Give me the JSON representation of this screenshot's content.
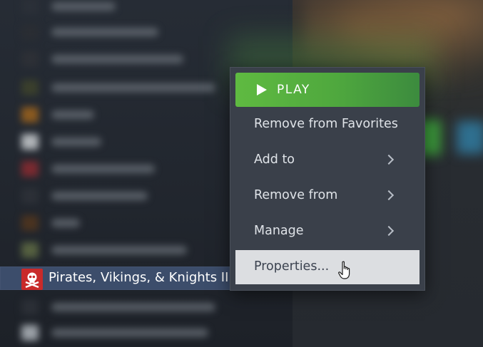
{
  "context_menu": {
    "play_label": "PLAY",
    "items": [
      {
        "label": "Remove from Favorites",
        "has_submenu": false
      },
      {
        "label": "Add to",
        "has_submenu": true
      },
      {
        "label": "Remove from",
        "has_submenu": true
      },
      {
        "label": "Manage",
        "has_submenu": true
      },
      {
        "label": "Properties...",
        "has_submenu": false,
        "highlighted": true
      }
    ]
  },
  "selected_game": {
    "title": "Pirates, Vikings, & Knights II",
    "icon": "skull-crossbones-icon"
  },
  "colors": {
    "play_green": "#5fba41",
    "menu_bg": "#3a404a",
    "selected_row": "#3c4d6b",
    "highlight": "#dcdee1",
    "game_icon_red": "#c92a2a"
  }
}
